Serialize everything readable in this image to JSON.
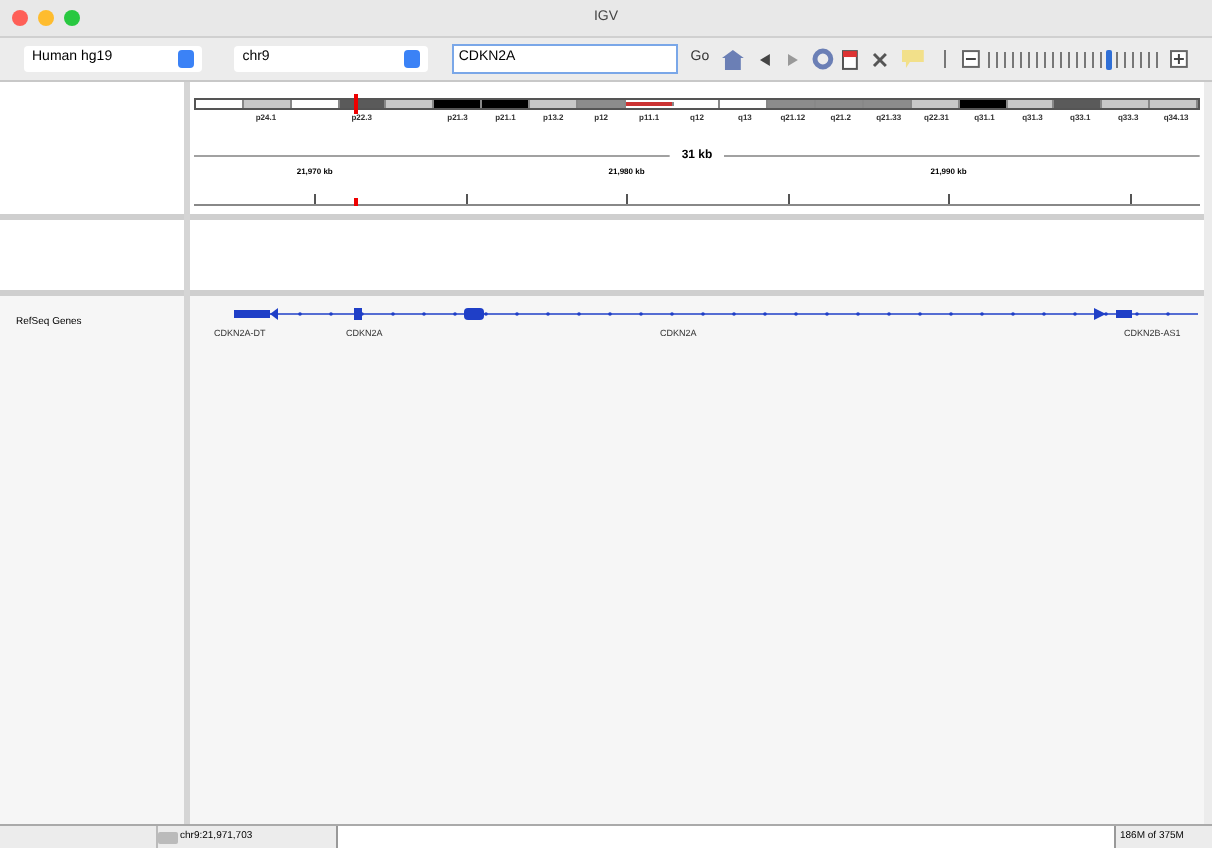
{
  "window": {
    "title": "IGV"
  },
  "toolbar": {
    "genome": "Human hg19",
    "chromosome": "chr9",
    "locus": "CDKN2A",
    "go": "Go",
    "zoom": {
      "level": 0.7
    }
  },
  "ideogram": {
    "bands": [
      {
        "kind": "gneg"
      },
      {
        "label": "p24.1",
        "kind": "gpos25"
      },
      {
        "kind": "gneg"
      },
      {
        "label": "p22.3",
        "kind": "gpos75"
      },
      {
        "kind": "gpos25"
      },
      {
        "label": "p21.3",
        "kind": "gpos100"
      },
      {
        "label": "p21.1",
        "kind": "gpos100"
      },
      {
        "label": "p13.2",
        "kind": "gpos25"
      },
      {
        "label": "p12",
        "kind": "gpos50"
      },
      {
        "label": "p11.1",
        "kind": "acen"
      },
      {
        "label": "q12",
        "kind": "gneg"
      },
      {
        "label": "q13",
        "kind": "gneg"
      },
      {
        "label": "q21.12",
        "kind": "gpos50"
      },
      {
        "label": "q21.2",
        "kind": "gpos50"
      },
      {
        "label": "q21.33",
        "kind": "gpos50"
      },
      {
        "label": "q22.31",
        "kind": "gpos25"
      },
      {
        "label": "q31.1",
        "kind": "gpos100"
      },
      {
        "label": "q31.3",
        "kind": "gpos25"
      },
      {
        "label": "q33.1",
        "kind": "gpos75"
      },
      {
        "label": "q33.3",
        "kind": "gpos25"
      },
      {
        "label": "q34.13",
        "kind": "gpos25"
      }
    ]
  },
  "ruler": {
    "span": "31 kb",
    "ticks": [
      "21,970 kb",
      "21,980 kb",
      "21,990 kb"
    ]
  },
  "tracks": [
    {
      "name": "RefSeq Genes",
      "genes": [
        "CDKN2A-DT",
        "CDKN2A",
        "CDKN2A",
        "CDKN2B-AS1"
      ]
    }
  ],
  "status_bar": {
    "locus": "chr9:21,971,703",
    "memory": "186M of 375M"
  }
}
